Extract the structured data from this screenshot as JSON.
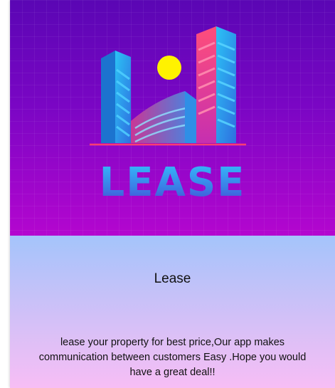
{
  "card": {
    "logo": {
      "wordmark": "LEASE",
      "icon": "city-buildings-with-sun-icon",
      "colors": {
        "background_top": "#5a06b4",
        "background_bottom": "#b406cf",
        "building_blue": "#29a3ea",
        "building_pink": "#e2457c",
        "sun": "#fff200",
        "ground_line": "#ff3c73"
      }
    },
    "title": "Lease",
    "description": "lease your property for best price,Our app makes communication between customers Easy .Hope you would have a great deal!!",
    "colors": {
      "content_top": "#a4c4fb",
      "content_bottom": "#f7bef5"
    }
  }
}
